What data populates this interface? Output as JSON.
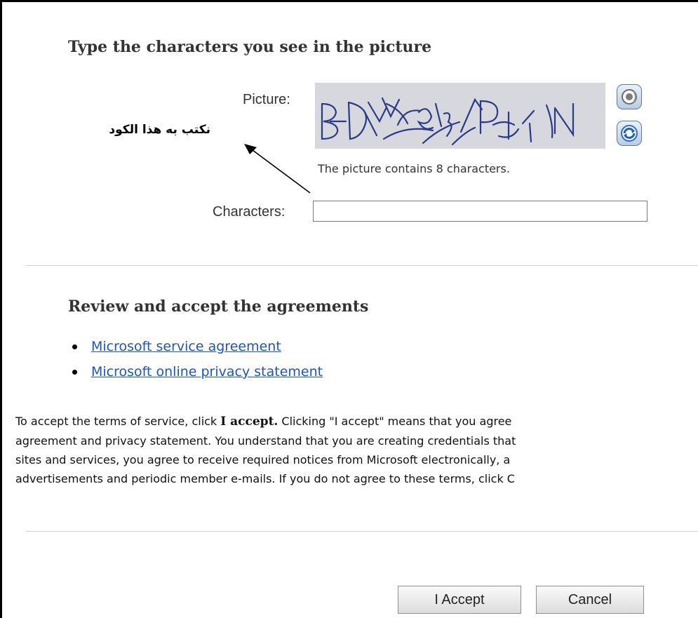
{
  "captcha_section": {
    "heading": "Type the characters you see in the picture",
    "picture_label": "Picture:",
    "captcha_text": "BDAY9M3PHJN",
    "hint": "The picture contains 8 characters.",
    "characters_label": "Characters:",
    "characters_value": ""
  },
  "annotation": {
    "note": "نكتب به هذا الكود"
  },
  "agreements": {
    "heading": "Review and accept the agreements",
    "links": [
      "Microsoft service agreement",
      "Microsoft online privacy statement"
    ]
  },
  "terms": {
    "line1_before": "To accept the terms of service, click ",
    "line1_bold": "I accept.",
    "line1_after": " Clicking \"I accept\" means that you agree",
    "line2": "agreement and privacy statement. You understand that you are creating credentials that",
    "line3": "sites and services, you agree to receive required notices from Microsoft electronically, a",
    "line4": "advertisements and periodic member e-mails. If you do not agree to these terms, click C"
  },
  "buttons": {
    "accept": "I Accept",
    "cancel": "Cancel"
  },
  "icons": {
    "audio": "speaker-icon",
    "refresh": "refresh-icon"
  }
}
